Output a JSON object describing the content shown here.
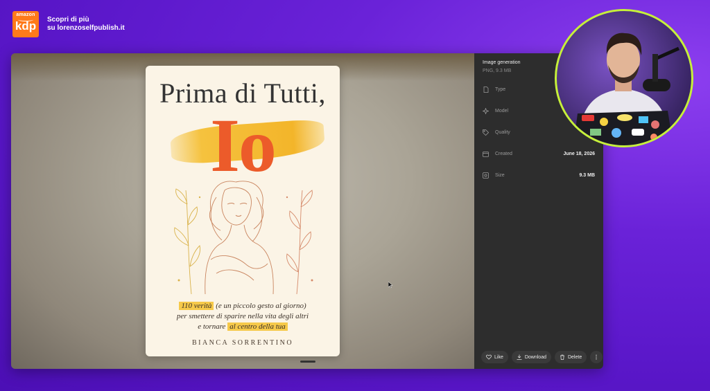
{
  "brand": {
    "logo_top": "amazon",
    "logo_main": "kdp",
    "line1": "Scopri di più",
    "line2": "su lorenzoselfpublish.it"
  },
  "cover": {
    "title": "Prima di Tutti,",
    "big_word": "Io",
    "subtitle_hl1": "110 verità",
    "subtitle_1": " (e un piccolo gesto al giorno)",
    "subtitle_2": "per smettere di sparire nella vita degli altri",
    "subtitle_3_pre": "e tornare ",
    "subtitle_hl2": "al centro della tua",
    "author": "BIANCA SORRENTINO"
  },
  "panel": {
    "title": "Image generation",
    "subtitle": "PNG, 9.3 MB",
    "rows": [
      {
        "label": "Type",
        "value": "",
        "icon": "file-icon"
      },
      {
        "label": "Model",
        "value": "",
        "icon": "sparkle-icon"
      },
      {
        "label": "Quality",
        "value": "",
        "icon": "tag-icon"
      },
      {
        "label": "Created",
        "value": "June 18, 2026",
        "icon": "calendar-icon"
      },
      {
        "label": "Size",
        "value": "9.3 MB",
        "icon": "disk-icon"
      }
    ],
    "actions": {
      "like": "Like",
      "download": "Download",
      "delete": "Delete"
    }
  },
  "colors": {
    "accent_border": "#c6f03a",
    "kdp_orange": "#ff7a1a",
    "cover_title_red": "#ec5b2a",
    "highlight_yellow": "#f6c94a"
  }
}
